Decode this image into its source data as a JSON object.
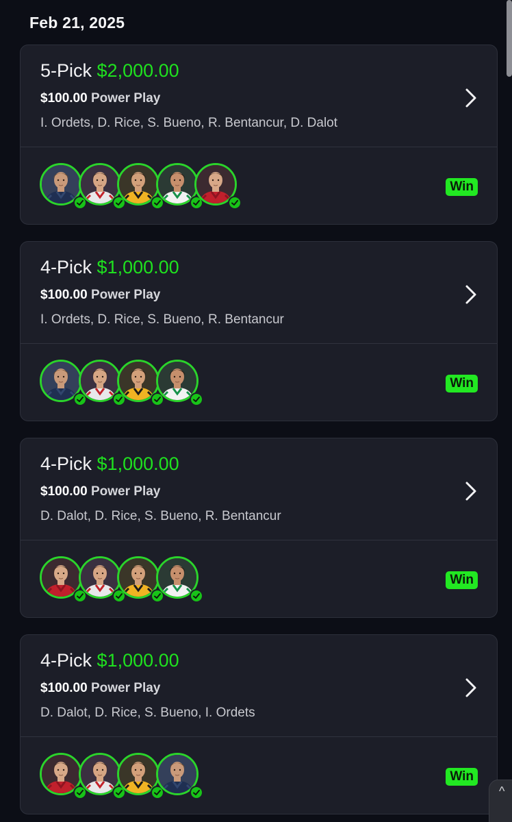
{
  "date_header": "Feb 21, 2025",
  "colors": {
    "background": "#0c0e16",
    "card": "#1c1e28",
    "accent_green": "#1fe11f",
    "win_badge": "#22e822"
  },
  "entries": [
    {
      "pick_label": "5-Pick",
      "payout": "$2,000.00",
      "wager": "$100.00",
      "play_type": "Power Play",
      "players_text": "I. Ordets, D. Rice, S. Bueno, R. Bentancur, D. Dalot",
      "result": "Win",
      "avatars": [
        "navy-kit-player",
        "red-white-kit-player",
        "gold-kit-player",
        "green-white-kit-player",
        "red-kit-player"
      ]
    },
    {
      "pick_label": "4-Pick",
      "payout": "$1,000.00",
      "wager": "$100.00",
      "play_type": "Power Play",
      "players_text": "I. Ordets, D. Rice, S. Bueno, R. Bentancur",
      "result": "Win",
      "avatars": [
        "navy-kit-player",
        "red-white-kit-player",
        "gold-kit-player",
        "green-white-kit-player"
      ]
    },
    {
      "pick_label": "4-Pick",
      "payout": "$1,000.00",
      "wager": "$100.00",
      "play_type": "Power Play",
      "players_text": "D. Dalot, D. Rice, S. Bueno, R. Bentancur",
      "result": "Win",
      "avatars": [
        "red-kit-player",
        "red-white-kit-player",
        "gold-kit-player",
        "green-white-kit-player"
      ]
    },
    {
      "pick_label": "4-Pick",
      "payout": "$1,000.00",
      "wager": "$100.00",
      "play_type": "Power Play",
      "players_text": "D. Dalot, D. Rice, S. Bueno, I. Ordets",
      "result": "Win",
      "avatars": [
        "red-kit-player",
        "red-white-kit-player",
        "gold-kit-player",
        "navy-kit-player"
      ]
    }
  ]
}
